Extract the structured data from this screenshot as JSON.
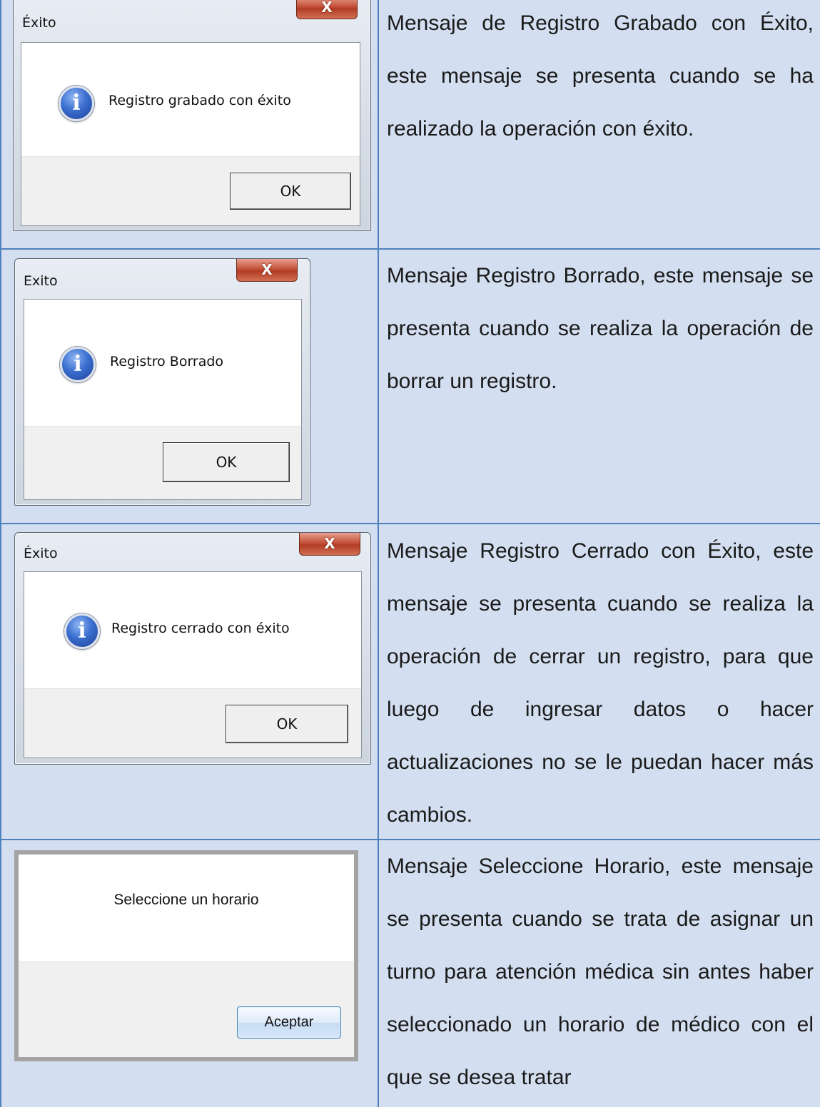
{
  "rows": [
    {
      "dialog": {
        "title": "Éxito",
        "close": "X",
        "message": "Registro grabado con éxito",
        "button": "OK"
      },
      "description": "Mensaje de Registro Grabado con Éxito, este mensaje se presenta cuando se ha realizado la operación con éxito."
    },
    {
      "dialog": {
        "title": "Exito",
        "close": "X",
        "message": "Registro Borrado",
        "button": "OK"
      },
      "description": "Mensaje Registro Borrado, este mensaje se presenta cuando se realiza la operación de borrar un registro."
    },
    {
      "dialog": {
        "title": "Éxito",
        "close": "X",
        "message": "Registro cerrado con éxito",
        "button": "OK"
      },
      "description": "Mensaje Registro Cerrado con Éxito, este mensaje se presenta cuando se realiza la operación de cerrar un registro, para que luego de ingresar datos o hacer actualizaciones no se le puedan hacer más cambios."
    },
    {
      "dialog": {
        "message": "Seleccione un horario",
        "button": "Aceptar"
      },
      "description": "Mensaje Seleccione Horario, este mensaje se presenta cuando se trata de asignar un turno para atención médica sin antes haber seleccionado un horario de médico con el que se desea tratar"
    }
  ]
}
